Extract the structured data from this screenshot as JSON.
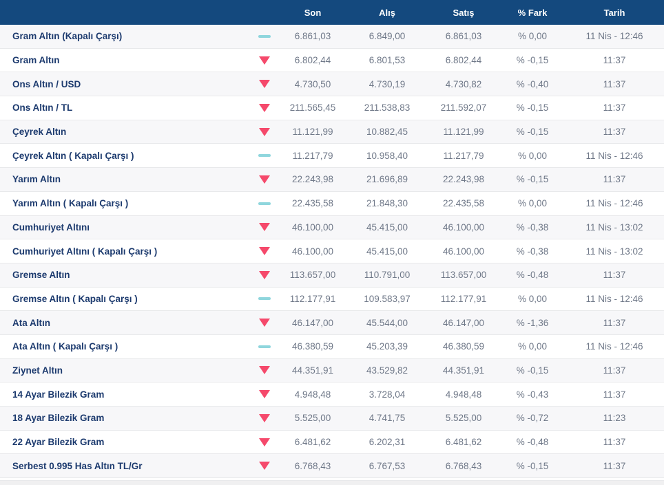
{
  "header": {
    "columns": [
      "Son",
      "Alış",
      "Satış",
      "% Fark",
      "Tarih"
    ]
  },
  "table": {
    "rows": [
      {
        "name": "Gram Altın (Kapalı Çarşı)",
        "trend": "flat",
        "son": "6.861,03",
        "alis": "6.849,00",
        "satis": "6.861,03",
        "fark": "% 0,00",
        "tarih": "11 Nis - 12:46"
      },
      {
        "name": "Gram Altın",
        "trend": "down",
        "son": "6.802,44",
        "alis": "6.801,53",
        "satis": "6.802,44",
        "fark": "% -0,15",
        "tarih": "11:37"
      },
      {
        "name": "Ons Altın / USD",
        "trend": "down",
        "son": "4.730,50",
        "alis": "4.730,19",
        "satis": "4.730,82",
        "fark": "% -0,40",
        "tarih": "11:37"
      },
      {
        "name": "Ons Altın / TL",
        "trend": "down",
        "son": "211.565,45",
        "alis": "211.538,83",
        "satis": "211.592,07",
        "fark": "% -0,15",
        "tarih": "11:37"
      },
      {
        "name": "Çeyrek Altın",
        "trend": "down",
        "son": "11.121,99",
        "alis": "10.882,45",
        "satis": "11.121,99",
        "fark": "% -0,15",
        "tarih": "11:37"
      },
      {
        "name": "Çeyrek Altın ( Kapalı Çarşı )",
        "trend": "flat",
        "son": "11.217,79",
        "alis": "10.958,40",
        "satis": "11.217,79",
        "fark": "% 0,00",
        "tarih": "11 Nis - 12:46"
      },
      {
        "name": "Yarım Altın",
        "trend": "down",
        "son": "22.243,98",
        "alis": "21.696,89",
        "satis": "22.243,98",
        "fark": "% -0,15",
        "tarih": "11:37"
      },
      {
        "name": "Yarım Altın ( Kapalı Çarşı )",
        "trend": "flat",
        "son": "22.435,58",
        "alis": "21.848,30",
        "satis": "22.435,58",
        "fark": "% 0,00",
        "tarih": "11 Nis - 12:46"
      },
      {
        "name": "Cumhuriyet Altını",
        "trend": "down",
        "son": "46.100,00",
        "alis": "45.415,00",
        "satis": "46.100,00",
        "fark": "% -0,38",
        "tarih": "11 Nis - 13:02"
      },
      {
        "name": "Cumhuriyet Altını ( Kapalı Çarşı )",
        "trend": "down",
        "son": "46.100,00",
        "alis": "45.415,00",
        "satis": "46.100,00",
        "fark": "% -0,38",
        "tarih": "11 Nis - 13:02"
      },
      {
        "name": "Gremse Altın",
        "trend": "down",
        "son": "113.657,00",
        "alis": "110.791,00",
        "satis": "113.657,00",
        "fark": "% -0,48",
        "tarih": "11:37"
      },
      {
        "name": "Gremse Altın ( Kapalı Çarşı )",
        "trend": "flat",
        "son": "112.177,91",
        "alis": "109.583,97",
        "satis": "112.177,91",
        "fark": "% 0,00",
        "tarih": "11 Nis - 12:46"
      },
      {
        "name": "Ata Altın",
        "trend": "down",
        "son": "46.147,00",
        "alis": "45.544,00",
        "satis": "46.147,00",
        "fark": "% -1,36",
        "tarih": "11:37"
      },
      {
        "name": "Ata Altın ( Kapalı Çarşı )",
        "trend": "flat",
        "son": "46.380,59",
        "alis": "45.203,39",
        "satis": "46.380,59",
        "fark": "% 0,00",
        "tarih": "11 Nis - 12:46"
      },
      {
        "name": "Ziynet Altın",
        "trend": "down",
        "son": "44.351,91",
        "alis": "43.529,82",
        "satis": "44.351,91",
        "fark": "% -0,15",
        "tarih": "11:37"
      },
      {
        "name": "14 Ayar Bilezik Gram",
        "trend": "down",
        "son": "4.948,48",
        "alis": "3.728,04",
        "satis": "4.948,48",
        "fark": "% -0,43",
        "tarih": "11:37"
      },
      {
        "name": "18 Ayar Bilezik Gram",
        "trend": "down",
        "son": "5.525,00",
        "alis": "4.741,75",
        "satis": "5.525,00",
        "fark": "% -0,72",
        "tarih": "11:23"
      },
      {
        "name": "22 Ayar Bilezik Gram",
        "trend": "down",
        "son": "6.481,62",
        "alis": "6.202,31",
        "satis": "6.481,62",
        "fark": "% -0,48",
        "tarih": "11:37"
      },
      {
        "name": "Serbest 0.995 Has Altın TL/Gr",
        "trend": "down",
        "son": "6.768,43",
        "alis": "6.767,53",
        "satis": "6.768,43",
        "fark": "% -0,15",
        "tarih": "11:37"
      }
    ]
  },
  "icons": {
    "trend_down": "triangle-down-icon",
    "trend_flat": "dash-icon"
  },
  "colors": {
    "header_bg": "#14497e",
    "header_text": "#ffffff",
    "name_text": "#1c3a6e",
    "value_text": "#6f7888",
    "alt_row_bg": "#f7f7f9",
    "row_border": "#e8e9eb",
    "trend_down": "#f5496b",
    "trend_flat": "#8fd6dd"
  }
}
